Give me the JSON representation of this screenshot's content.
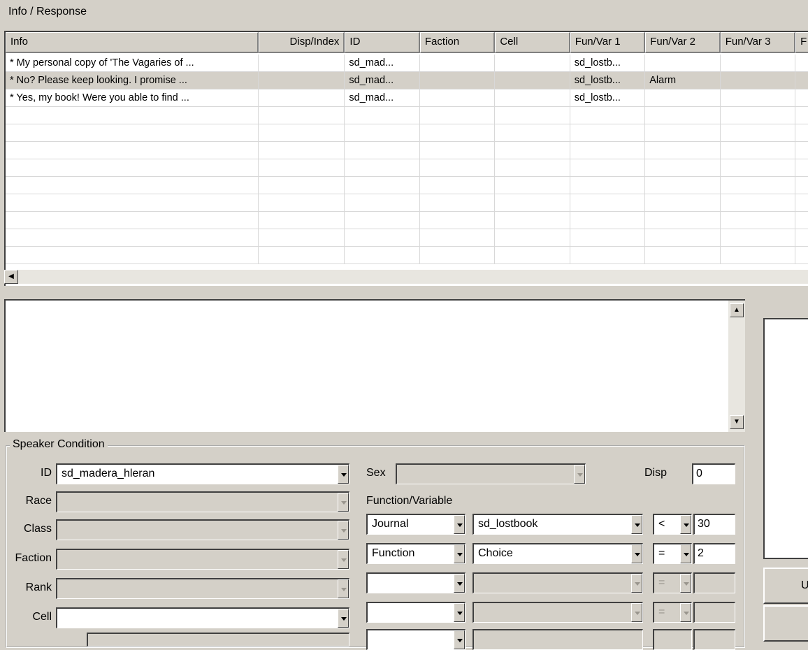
{
  "panel_title": "Info / Response",
  "table": {
    "columns": [
      "Info",
      "Disp/Index",
      "ID",
      "Faction",
      "Cell",
      "Fun/Var 1",
      "Fun/Var 2",
      "Fun/Var 3",
      "F"
    ],
    "rows": [
      {
        "info": "* My personal copy of 'The Vagaries of ...",
        "disp": "",
        "id": "sd_mad...",
        "faction": "",
        "cell": "",
        "fv1": "sd_lostb...",
        "fv2": "",
        "fv3": ""
      },
      {
        "info": "* No?  Please keep looking.  I promise ...",
        "disp": "",
        "id": "sd_mad...",
        "faction": "",
        "cell": "",
        "fv1": "sd_lostb...",
        "fv2": "Alarm",
        "fv3": ""
      },
      {
        "info": "* Yes, my book!  Were you able to find ...",
        "disp": "",
        "id": "sd_mad...",
        "faction": "",
        "cell": "",
        "fv1": "sd_lostb...",
        "fv2": "",
        "fv3": ""
      }
    ],
    "selected_row": 1
  },
  "response_text": "",
  "right_button_label": "U",
  "speaker": {
    "group_label": "Speaker Condition",
    "id_label": "ID",
    "id_value": "sd_madera_hleran",
    "race_label": "Race",
    "class_label": "Class",
    "faction_label": "Faction",
    "rank_label": "Rank",
    "cell_label": "Cell",
    "sex_label": "Sex",
    "disp_label": "Disp",
    "disp_value": "0",
    "funcvar_label": "Function/Variable",
    "conditions": [
      {
        "type": "Journal",
        "name": "sd_lostbook",
        "op": "<",
        "value": "30",
        "enabled": true
      },
      {
        "type": "Function",
        "name": "Choice",
        "op": "=",
        "value": "2",
        "enabled": true
      },
      {
        "type": "",
        "name": "",
        "op": "=",
        "value": "",
        "enabled": false
      },
      {
        "type": "",
        "name": "",
        "op": "=",
        "value": "",
        "enabled": false
      }
    ]
  }
}
